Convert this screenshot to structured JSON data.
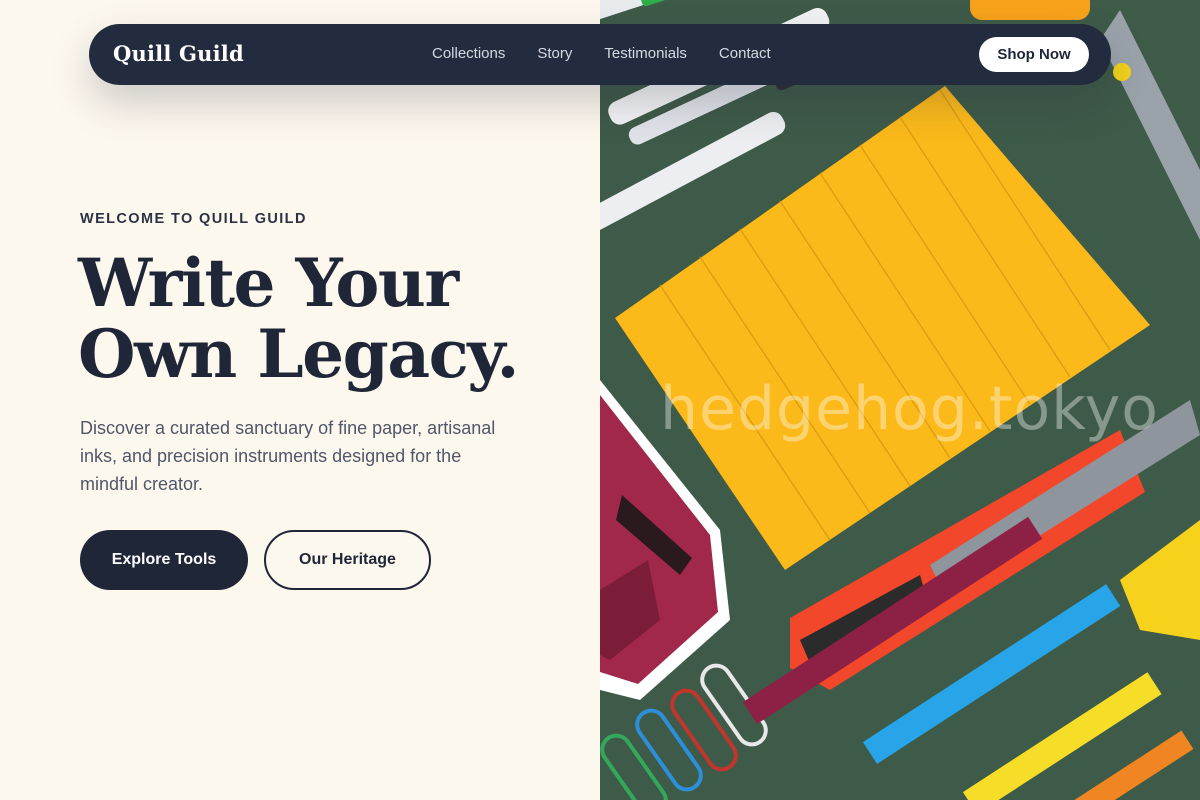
{
  "nav": {
    "brand": "Quill Guild",
    "links": [
      "Collections",
      "Story",
      "Testimonials",
      "Contact"
    ],
    "cta": "Shop Now"
  },
  "hero": {
    "eyebrow": "WELCOME TO QUILL GUILD",
    "headline_line1": "Write Your",
    "headline_line2": "Own Legacy.",
    "description": "Discover a curated sanctuary of fine paper, artisanal inks, and precision instruments designed for the mindful creator.",
    "primary_cta": "Explore Tools",
    "secondary_cta": "Our Heritage"
  },
  "image": {
    "watermark": "hedgehog.tokyo"
  },
  "colors": {
    "background": "#fdf8ee",
    "navy": "#1e2638",
    "nav_bg": "#232c3e",
    "photo_bg": "#3e5a48",
    "sticky_note": "#fbb91a"
  }
}
